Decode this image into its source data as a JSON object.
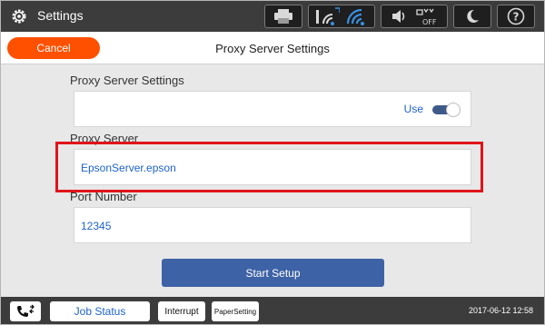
{
  "topbar": {
    "title": "Settings",
    "icons": [
      "gear-icon",
      "printer-icon",
      "wifi-direct-icon",
      "wifi-icon",
      "volume-icon",
      "quiet-off-icon",
      "sleep-icon",
      "help-icon"
    ]
  },
  "header": {
    "cancel_label": "Cancel",
    "title": "Proxy Server Settings"
  },
  "form": {
    "proxy_settings_label": "Proxy Server Settings",
    "use_label": "Use",
    "use_enabled": true,
    "proxy_server_label": "Proxy Server",
    "proxy_server_value": "EpsonServer.epson",
    "port_label": "Port Number",
    "port_value": "12345",
    "start_label": "Start Setup"
  },
  "bottombar": {
    "job_status_label": "Job Status",
    "interrupt_label": "Interrupt",
    "paper_setting_label": "PaperSetting",
    "datetime": "2017-06-12 12:58"
  },
  "colors": {
    "cancel": "#ff5000",
    "accent_text": "#1e63c8",
    "start_button": "#3e62a6",
    "highlight": "#e0141b",
    "bar": "#3c3c3c"
  }
}
